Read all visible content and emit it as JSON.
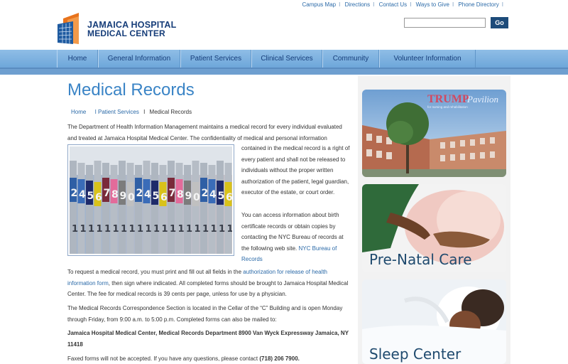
{
  "header": {
    "top_links": [
      "Campus Map",
      "Directions",
      "Contact Us",
      "Ways to Give",
      "Phone Directory"
    ],
    "logo_line1": "JAMAICA HOSPITAL",
    "logo_line2": "MEDICAL CENTER",
    "search_value": "",
    "search_button": "Go"
  },
  "nav": {
    "items": [
      "Home",
      "General Information",
      "Patient Services",
      "Clinical Services",
      "Community",
      "Volunteer Information"
    ]
  },
  "page": {
    "title": "Medical Records",
    "breadcrumb": {
      "home": "Home",
      "section": "I Patient Services",
      "sep": "I",
      "current": "Medical Records"
    },
    "intro": "The Department of Health Information Management maintains a medical record for every individual evaluated and treated at Jamaica Hospital Medical Center. The confidentiality of medical and personal information",
    "intro_cont": "contained in the medical record is a right of every patient and shall not be released to individuals without the proper written authorization of the patient, legal guardian, executor of the estate, or court order.",
    "birth_text": "You can access information about birth certificate records or obtain copies by contacting the NYC Bureau of records at the following web site.",
    "birth_link": "NYC Bureau of Records",
    "request_pre": "To request a medical record, you must print and fill out all fields in the",
    "request_link": "authorization for release of health information form",
    "request_post": ", then sign where indicated. All completed forms should be brought to Jamaica Hospital Medical Center. The fee for medical records is 39 cents per page, unless for use by a physician.",
    "correspondence": "The Medical Records Correspondence Section is located in the Cellar of the “C” Building and is open Monday through Friday, from 9:00 a.m. to 5:00 p.m. Completed forms can also be mailed to:",
    "address": "Jamaica Hospital Medical Center, Medical Records Department 8900 Van Wyck Expressway Jamaica, NY 11418",
    "faxed_pre": "Faxed forms will not be accepted. If you have any questions, please contact",
    "faxed_phone": "(718) 206 7900."
  },
  "photo": {
    "tab_numbers": [
      "2",
      "4",
      "5",
      "6",
      "7",
      "8",
      "9",
      "0"
    ]
  },
  "sidebar": {
    "pavilion_brand": "TRUMP",
    "pavilion_script": "Pavilion",
    "pavilion_sub": "for nursing and rehabilitation",
    "prenatal_label": "Pre-Natal Care",
    "sleep_label": "Sleep Center"
  },
  "colors": {
    "brand_navy": "#163d79",
    "link_blue": "#2b6aa8",
    "title_blue": "#3a84c6",
    "nav_blue": "#7fb2df",
    "logo_orange": "#e8731c"
  }
}
